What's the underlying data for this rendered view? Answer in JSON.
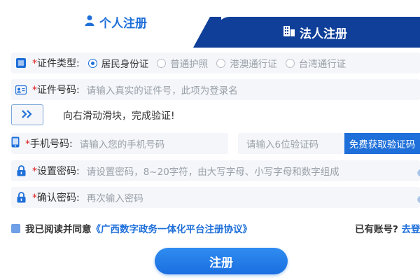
{
  "tabs": {
    "personal": "个人注册",
    "legal": "法人注册"
  },
  "id_type": {
    "label_req": "*",
    "label": "证件类型:",
    "options": [
      "居民身份证",
      "普通护照",
      "港澳通行证",
      "台湾通行证"
    ],
    "selected": "居民身份证"
  },
  "id_number": {
    "label_req": "*",
    "label": "证件号码:",
    "placeholder": "请输入真实的证件号，此项为登录名"
  },
  "slider": {
    "text": "向右滑动滑块，完成验证!"
  },
  "phone": {
    "label_req": "*",
    "label": "手机号码:",
    "placeholder": "请输入您的手机号码",
    "code_placeholder": "请输入6位验证码",
    "get_code": "免费获取验证码"
  },
  "password": {
    "label_req": "*",
    "label": "设置密码:",
    "placeholder": "请设置密码，8~20字符，由大写字母、小写字母和数字组成"
  },
  "confirm": {
    "label_req": "*",
    "label": "确认密码:",
    "placeholder": "再次输入密码"
  },
  "agree": {
    "text": "我已阅读并同意",
    "link": "《广西数字政务一体化平台注册协议》"
  },
  "login": {
    "text": "已有账号?",
    "link": "去登"
  },
  "submit": "注册",
  "colors": {
    "primary": "#1e6fd9",
    "dark_tab": "#0f3f99",
    "required": "#e02020"
  }
}
